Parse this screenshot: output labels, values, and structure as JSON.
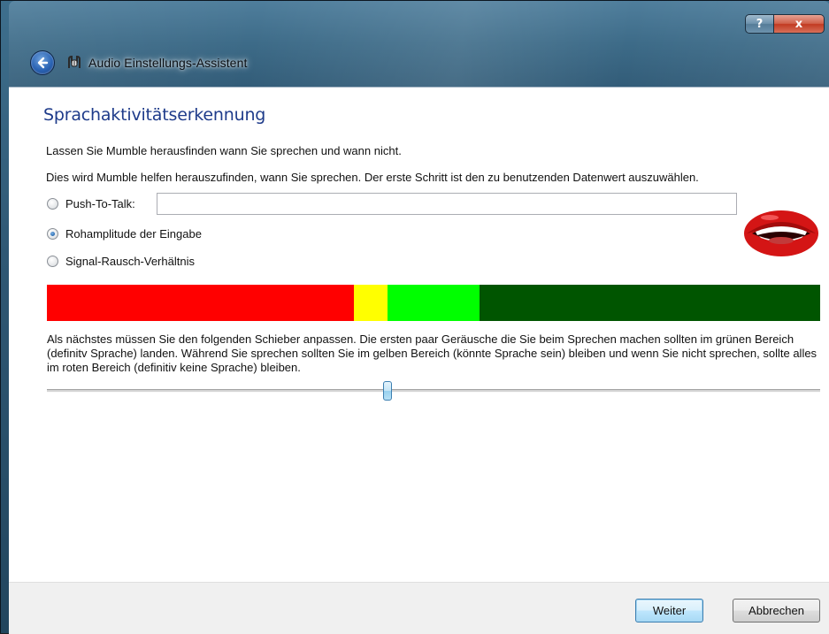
{
  "window": {
    "title": "Audio Einstellungs-Assistent",
    "caption_help": "?",
    "caption_close": "x"
  },
  "page": {
    "heading": "Sprachaktivitätserkennung",
    "intro_line1": "Lassen Sie Mumble herausfinden wann Sie sprechen und wann nicht.",
    "intro_line2": "Dies wird Mumble helfen herauszufinden, wann Sie sprechen. Der erste Schritt ist den zu benutzenden Datenwert auszuwählen."
  },
  "options": {
    "ptt_label": "Push-To-Talk:",
    "ptt_value": "",
    "raw_label": "Rohamplitude der Eingabe",
    "snr_label": "Signal-Rausch-Verhältnis",
    "selected": "raw"
  },
  "meter": {
    "segments": [
      {
        "zone": "red",
        "fraction": 0.397,
        "color": "#ff0000"
      },
      {
        "zone": "yellow",
        "fraction": 0.044,
        "color": "#ffff00"
      },
      {
        "zone": "light-green",
        "fraction": 0.118,
        "color": "#00ff00"
      },
      {
        "zone": "dark-green",
        "fraction": 0.441,
        "color": "#005500"
      }
    ]
  },
  "instructions": "Als nächstes müssen Sie den folgenden Schieber anpassen. Die ersten paar Geräusche die Sie beim Sprechen machen sollten im grünen Bereich (definitv Sprache) landen. Während Sie sprechen sollten Sie im gelben Bereich (könnte Sprache sein) bleiben und wenn Sie nicht sprechen, sollte alles im roten Bereich (definitiv keine Sprache) bleiben.",
  "slider": {
    "value_fraction": 0.441
  },
  "buttons": {
    "next": "Weiter",
    "cancel": "Abbrechen"
  },
  "icons": {
    "back": "back-arrow-icon",
    "app": "mumble-icon",
    "mouth": "mouth-icon"
  }
}
